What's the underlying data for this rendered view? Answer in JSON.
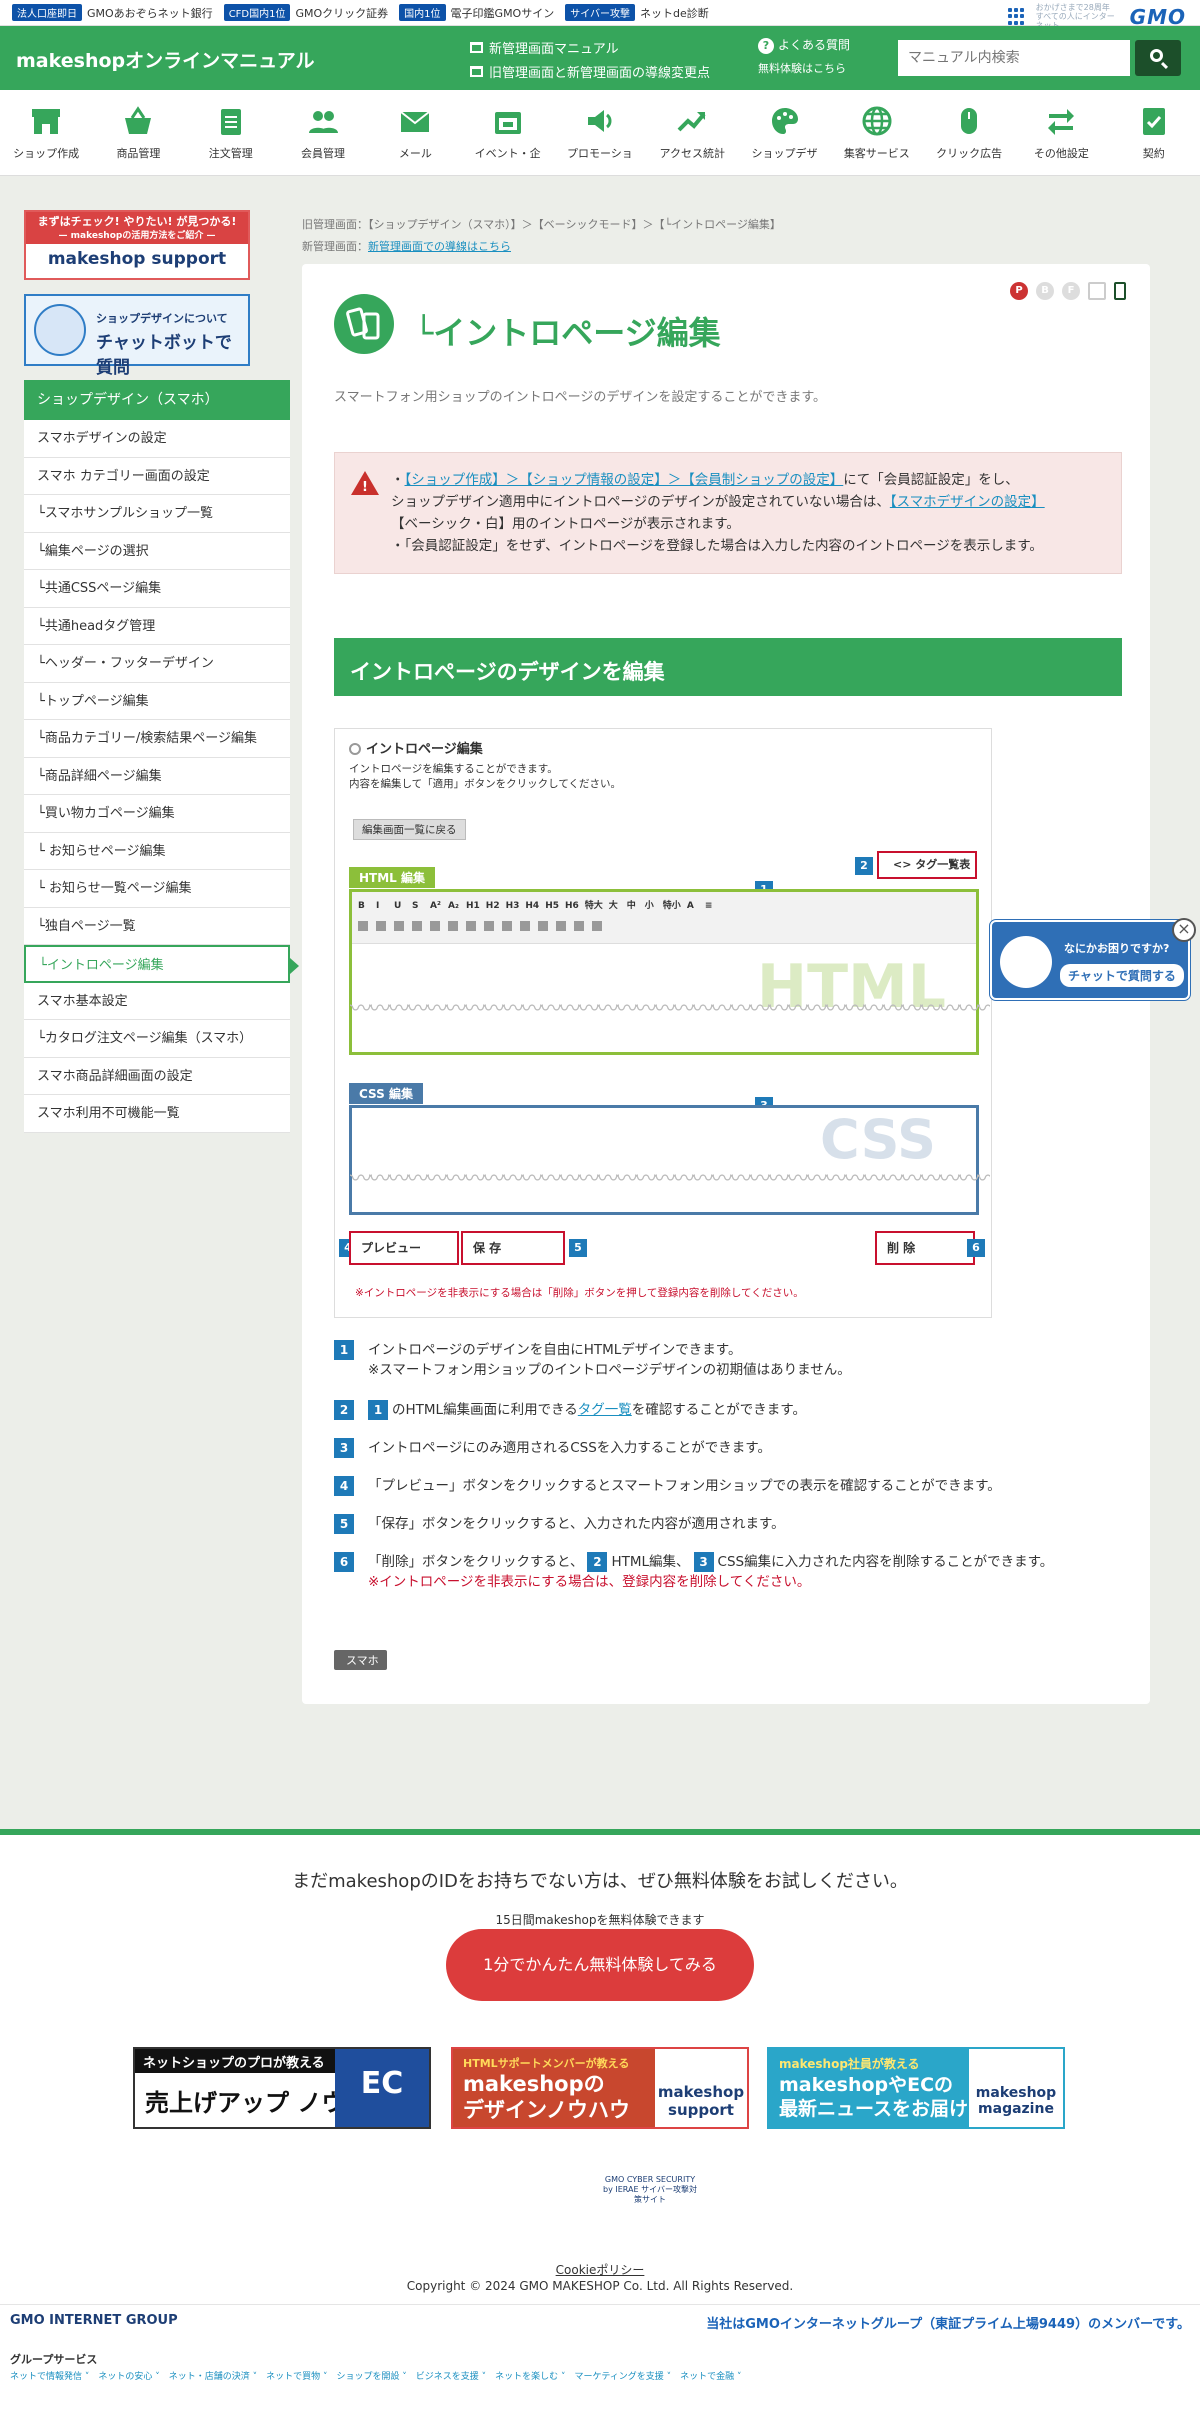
{
  "topbar": {
    "items": [
      {
        "badge": "法人口座即日",
        "text": "GMOあおぞらネット銀行"
      },
      {
        "badge": "CFD国内1位",
        "text": "GMOクリック証券"
      },
      {
        "badge": "国内1位",
        "text": "電子印鑑GMOサイン"
      },
      {
        "badge": "サイバー攻撃",
        "text": "ネットde診断"
      }
    ],
    "gmo_tagline": "おかげさまで28周年 すべての人にインターネット",
    "gmo_logo": "GMO"
  },
  "header": {
    "site_title": "makeshopオンラインマニュアル",
    "link1": "新管理画面マニュアル",
    "link2": "旧管理画面と新管理画面の導線変更点",
    "faq": "よくある質問",
    "trial": "無料体験はこちら",
    "search_placeholder": "マニュアル内検索"
  },
  "nav": [
    {
      "label": "ショップ作成",
      "icon": "shop-icon"
    },
    {
      "label": "商品管理",
      "icon": "basket-icon"
    },
    {
      "label": "注文管理",
      "icon": "clipboard-icon"
    },
    {
      "label": "会員管理",
      "icon": "users-icon"
    },
    {
      "label": "メール",
      "icon": "mail-icon"
    },
    {
      "label": "イベント・企",
      "icon": "event-icon"
    },
    {
      "label": "プロモーショ",
      "icon": "speaker-icon"
    },
    {
      "label": "アクセス統計",
      "icon": "trend-icon"
    },
    {
      "label": "ショップデザ",
      "icon": "palette-icon"
    },
    {
      "label": "集客サービス",
      "icon": "globe-icon"
    },
    {
      "label": "クリック広告",
      "icon": "mouse-icon"
    },
    {
      "label": "その他設定",
      "icon": "swap-icon"
    },
    {
      "label": "契約",
      "icon": "contract-icon"
    }
  ],
  "sidebar": {
    "banner1_line1": "まずはチェック! やりたい! が見つかる!",
    "banner1_line2": "— makeshopの活用方法をご紹介 —",
    "banner1_logo": "makeshop support",
    "banner2_line1": "ショップデザインについて",
    "banner2_line2": "チャットボットで質問",
    "menu_head": "ショップデザイン（スマホ）",
    "items": [
      "スマホデザインの設定",
      "スマホ カテゴリー画面の設定",
      "└スマホサンプルショップ一覧",
      "└編集ページの選択",
      "└共通CSSページ編集",
      "└共通headタグ管理",
      "└ヘッダー・フッターデザイン",
      "└トップページ編集",
      "└商品カテゴリー/検索結果ページ編集",
      "└商品詳細ページ編集",
      "└買い物カゴページ編集",
      "└ お知らせページ編集",
      "└ お知らせ一覧ページ編集",
      "└独自ページ一覧",
      "└イントロページ編集",
      "スマホ基本設定",
      "└カタログ注文ページ編集（スマホ）",
      "スマホ商品詳細画面の設定",
      "スマホ利用不可機能一覧"
    ]
  },
  "breadcrumb": {
    "old_label": "旧管理画面：",
    "old_path": "【ショップデザイン（スマホ）】＞【ベーシックモード】＞【└イントロページ編集】",
    "new_label": "新管理画面：",
    "new_link": "新管理画面での導線はこちら"
  },
  "main": {
    "device_badges": [
      "P",
      "B",
      "F",
      "PC",
      "SP"
    ],
    "title": "└イントロページ編集",
    "lead": "スマートフォン用ショップのイントロページのデザインを設定することができます。",
    "alert_a1": "・",
    "alert_a2": "【ショップ作成】＞【ショップ情報の設定】＞【会員制ショップの設定】",
    "alert_a3": "にて「会員認証設定」をし、",
    "alert_b1": "ショップデザイン適用中にイントロページのデザインが設定されていない場合は、",
    "alert_b2": "【スマホデザインの設定】",
    "alert_c": "【ベーシック・白】用のイントロページが表示されます。",
    "alert_d": "・「会員認証設定」をせず、イントロページを登録した場合は入力した内容のイントロページを表示します。",
    "section_heading": "イントロページのデザインを編集",
    "editor": {
      "radio_label": "イントロページ編集",
      "desc1": "イントロページを編集することができます。",
      "desc2": "内容を編集して「適用」ボタンをクリックしてください。",
      "back_btn": "編集画面一覧に戻る",
      "tag_ref": "<> タグ一覧表",
      "html_tab": "HTML 編集",
      "html_watermark": "HTML",
      "toolbar_row1": [
        "B",
        "I",
        "U",
        "S",
        "A²",
        "A₂",
        "H1",
        "H2",
        "H3",
        "H4",
        "H5",
        "H6",
        "特大",
        "大",
        "中",
        "小",
        "特小",
        "A",
        "≡"
      ],
      "css_tab": "CSS 編集",
      "css_watermark": "CSS",
      "preview_btn": "プレビュー",
      "save_btn": "保 存",
      "delete_btn": "削 除",
      "note": "※イントロページを非表示にする場合は「削除」ボタンを押して登録内容を削除してください。"
    },
    "steps": {
      "s1_num": "1",
      "s1_a": "イントロページのデザインを自由にHTMLデザインできます。",
      "s1_b": "※スマートフォン用ショップのイントロページデザインの初期値はありません。",
      "s2_num": "2",
      "s2_inner": "1",
      "s2_a": "のHTML編集画面に利用できる",
      "s2_link": "タグ一覧",
      "s2_b": "を確認することができます。",
      "s3_num": "3",
      "s3": "イントロページにのみ適用されるCSSを入力することができます。",
      "s4_num": "4",
      "s4": "「プレビュー」ボタンをクリックするとスマートフォン用ショップでの表示を確認することができます。",
      "s5_num": "5",
      "s5": "「保存」ボタンをクリックすると、入力された内容が適用されます。",
      "s6_num": "6",
      "s6_a": "「削除」ボタンをクリックすると、",
      "s6_n2": "2",
      "s6_b": "HTML編集、",
      "s6_n3": "3",
      "s6_c": "CSS編集に入力された内容を削除することができます。",
      "s6_note": "※イントロページを非表示にする場合は、登録内容を削除してください。"
    },
    "tag": "スマホ"
  },
  "chat": {
    "line1": "なにかお困りですか?",
    "line2": "チャットで質問する"
  },
  "footer": {
    "trial_title": "まだmakeshopのIDをお持ちでない方は、ぜひ無料体験をお試しください。",
    "trial_sub": "15日間makeshopを無料体験できます",
    "trial_btn": "1分でかんたん無料体験してみる",
    "b1_t1": "ネットショップのプロが教える",
    "b1_t2": "売上げアップ ノウハウ",
    "b1_r": "EC",
    "b2_t1": "HTMLサポートメンバーが教える",
    "b2_t2a": "makeshopの",
    "b2_t2b": "デザインノウハウ",
    "b2_r": "makeshop support",
    "b3_t1": "makeshop社員が教える",
    "b3_t2a": "makeshopやECの",
    "b3_t2b": "最新ニュースをお届け",
    "b3_r": "makeshop magazine",
    "cyber": "GMO CYBER SECURITY by IERAE サイバー攻撃対策サイト",
    "cookie": "Cookieポリシー",
    "copyright": "Copyright © 2024 GMO MAKESHOP Co. Ltd. All Rights Reserved.",
    "gmo_ig": "GMO INTERNET GROUP",
    "member": "当社はGMOインターネットグループ（東証プライム上場9449）のメンバーです。",
    "gs_label": "グループサービス",
    "gs_links": "ネットで情報発信 ˅　ネットの安心 ˅　ネット・店舗の決済 ˅　ネットで買物 ˅　ショップを開設 ˅　ビジネスを支援 ˅　ネットを楽しむ ˅　マーケティングを支援 ˅　ネットで金融 ˅"
  },
  "colors": {
    "brand": "#36a65b",
    "link": "#1a8fc0",
    "alert": "#c8102e",
    "step": "#1e7ab8"
  }
}
